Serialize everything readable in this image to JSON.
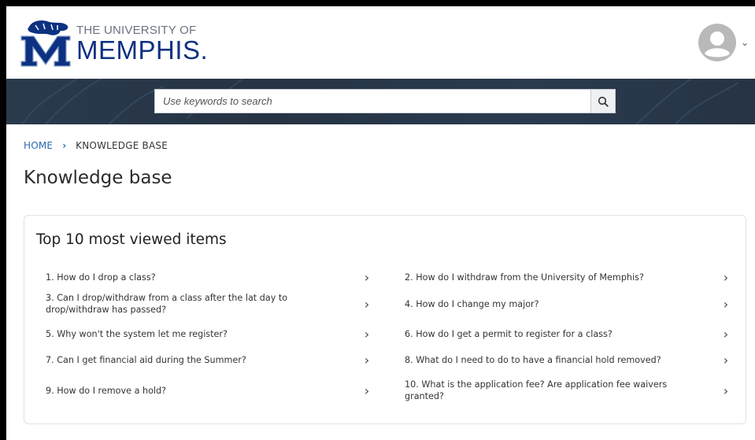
{
  "header": {
    "logo_small": "THE UNIVERSITY OF",
    "logo_big": "MEMPHIS.",
    "logo_icon": "tiger-m-logo",
    "avatar_icon": "user-avatar-icon",
    "caret": "⌄"
  },
  "search": {
    "placeholder": "Use keywords to search",
    "button_icon": "search-icon"
  },
  "breadcrumb": {
    "home": "HOME",
    "separator": "›",
    "current": "KNOWLEDGE BASE"
  },
  "page": {
    "title": "Knowledge base"
  },
  "top_items": {
    "title": "Top 10 most viewed items",
    "items": [
      {
        "text": "1. How do I drop a class?"
      },
      {
        "text": "2. How do I withdraw from the University of Memphis?"
      },
      {
        "text": "3. Can I drop/withdraw from a class after the lat day to drop/withdraw has passed?"
      },
      {
        "text": "4. How do I change my major?"
      },
      {
        "text": "5. Why won't the system let me register?"
      },
      {
        "text": "6. How do I get a permit to register for a class?"
      },
      {
        "text": "7. Can I get financial aid during the Summer?"
      },
      {
        "text": "8. What do I need to do to have a financial hold removed?"
      },
      {
        "text": "9. How do I remove a hold?"
      },
      {
        "text": "10. What is the application fee? Are application fee waivers granted?"
      }
    ],
    "chevron": "›"
  },
  "colors": {
    "brand_blue": "#0d3182",
    "link_blue": "#2b6cb0",
    "band_dark": "#253344"
  }
}
